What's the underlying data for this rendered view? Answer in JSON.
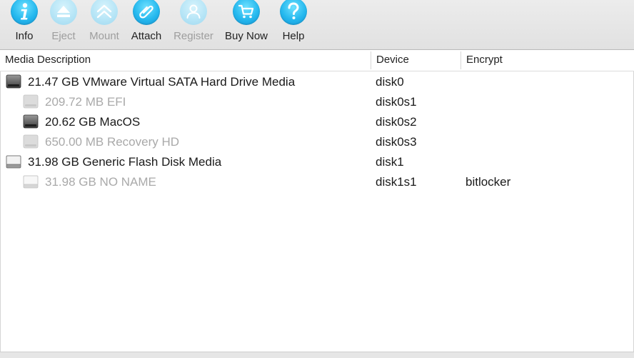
{
  "toolbar": {
    "buttons": [
      {
        "label": "Info",
        "icon": "info-icon",
        "enabled": true
      },
      {
        "label": "Eject",
        "icon": "eject-icon",
        "enabled": false
      },
      {
        "label": "Mount",
        "icon": "mount-icon",
        "enabled": false
      },
      {
        "label": "Attach",
        "icon": "attach-icon",
        "enabled": true
      },
      {
        "label": "Register",
        "icon": "register-icon",
        "enabled": false
      },
      {
        "label": "Buy Now",
        "icon": "cart-icon",
        "enabled": true
      },
      {
        "label": "Help",
        "icon": "help-icon",
        "enabled": true
      }
    ]
  },
  "table": {
    "columns": [
      "Media Description",
      "Device",
      "Encrypt"
    ],
    "rows": [
      {
        "description": "21.47 GB VMware Virtual SATA Hard Drive Media",
        "device": "disk0",
        "encrypt": "",
        "indent": 0,
        "enabled": true,
        "icon": "hard-drive-icon"
      },
      {
        "description": "209.72 MB EFI",
        "device": "disk0s1",
        "encrypt": "",
        "indent": 1,
        "enabled": false,
        "icon": "hard-drive-icon"
      },
      {
        "description": "20.62 GB MacOS",
        "device": "disk0s2",
        "encrypt": "",
        "indent": 1,
        "enabled": true,
        "icon": "hard-drive-icon"
      },
      {
        "description": "650.00 MB Recovery HD",
        "device": "disk0s3",
        "encrypt": "",
        "indent": 1,
        "enabled": false,
        "icon": "hard-drive-icon"
      },
      {
        "description": "31.98 GB Generic Flash Disk Media",
        "device": "disk1",
        "encrypt": "",
        "indent": 0,
        "enabled": true,
        "icon": "external-drive-icon"
      },
      {
        "description": "31.98 GB NO NAME",
        "device": "disk1s1",
        "encrypt": "bitlocker",
        "indent": 1,
        "enabled": false,
        "icon": "external-drive-icon"
      }
    ]
  },
  "colors": {
    "accent": "#25b8ee",
    "accent_disabled": "#b4e4f6",
    "text": "#1a1a1a",
    "text_disabled": "#a9a9a9"
  }
}
